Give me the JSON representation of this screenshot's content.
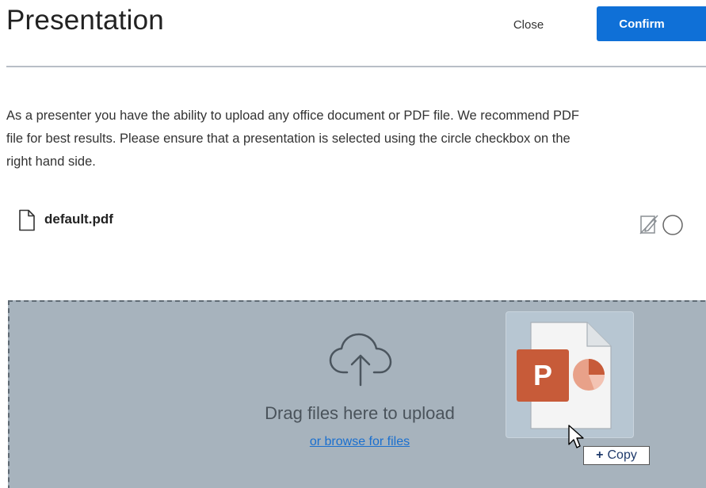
{
  "header": {
    "title": "Presentation",
    "close_label": "Close",
    "confirm_label": "Confirm"
  },
  "description": {
    "lines": [
      "As a presenter you have the ability to upload any office document or PDF file. We recommend PDF",
      "file for best results. Please ensure that a presentation is selected using the circle checkbox on the",
      "right hand side."
    ]
  },
  "files": [
    {
      "name": "default.pdf",
      "icon": "file-icon",
      "selected": false
    }
  ],
  "dropzone": {
    "drag_text": "Drag files here to upload",
    "browse_text": "or browse for files",
    "icon": "cloud-upload-icon"
  },
  "drag_preview": {
    "icon": "powerpoint-file-icon",
    "badge_letter": "P",
    "tooltip_symbol": "+",
    "tooltip_label": "Copy"
  },
  "colors": {
    "accent": "#0f70d7",
    "dropzone_bg": "#a7b3bd",
    "link": "#1a6fcf",
    "powerpoint": "#c75b39"
  }
}
